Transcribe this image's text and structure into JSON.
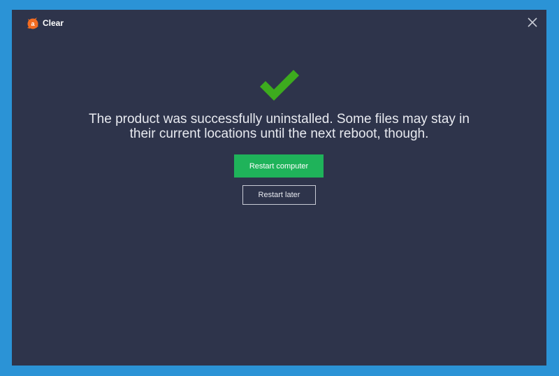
{
  "window": {
    "title": "Clear"
  },
  "icons": {
    "logo": "avast-logo-icon",
    "close": "close-icon",
    "success": "checkmark-icon"
  },
  "colors": {
    "frame": "#2b93d6",
    "background": "#2e344b",
    "checkmark": "#3dab1e",
    "primary_button": "#1fb35a",
    "logo": "#f36c21"
  },
  "main": {
    "message_line1": "The product was successfully uninstalled. Some files may stay in",
    "message_line2": "their current locations until the next reboot, though.",
    "restart_now_label": "Restart computer",
    "restart_later_label": "Restart later"
  }
}
